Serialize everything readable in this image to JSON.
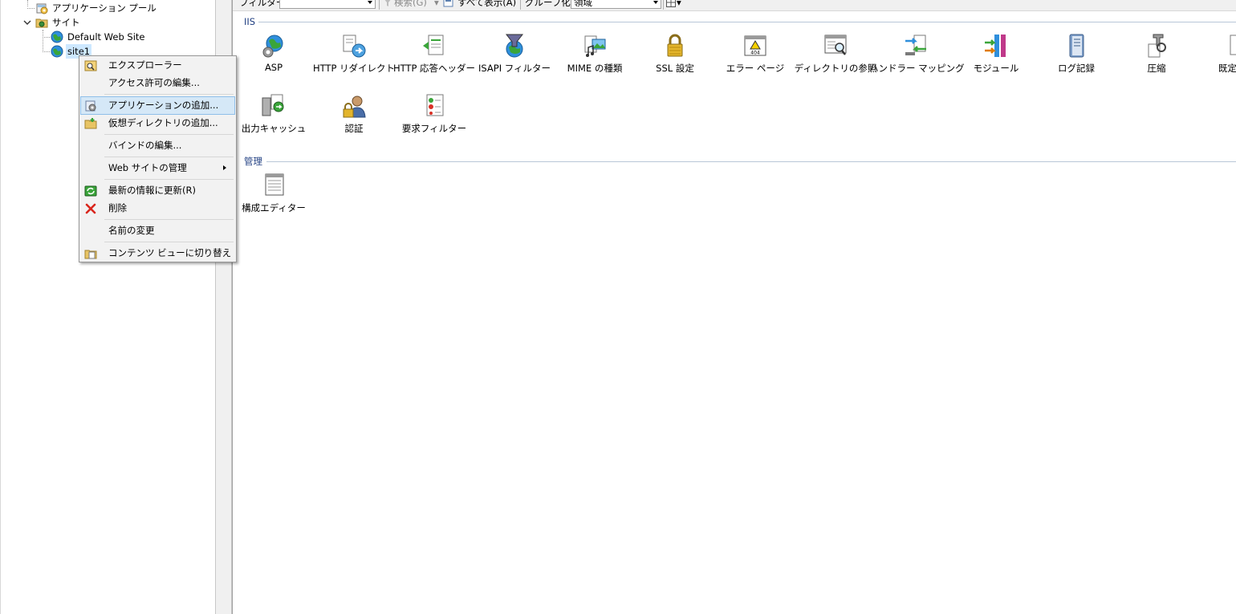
{
  "tree": {
    "items": [
      {
        "label": "アプリケーション プール"
      },
      {
        "label": "サイト"
      },
      {
        "label": "Default Web Site"
      },
      {
        "label": "site1"
      }
    ]
  },
  "toolbar": {
    "filter_label": "フィルター:",
    "filter_value": "",
    "search_label": "検索(G)",
    "show_all_label": "すべて表示(A)",
    "group_by_label": "グループ化:",
    "group_by_value": "領域"
  },
  "groups": {
    "iis": {
      "header": "IIS",
      "features": [
        {
          "label": "ASP",
          "icon": "asp-icon"
        },
        {
          "label": "HTTP リダイレクト",
          "icon": "http-redirect-icon"
        },
        {
          "label": "HTTP 応答ヘッダー",
          "icon": "http-response-headers-icon"
        },
        {
          "label": "ISAPI フィルター",
          "icon": "isapi-filters-icon"
        },
        {
          "label": "MIME の種類",
          "icon": "mime-types-icon"
        },
        {
          "label": "SSL 設定",
          "icon": "ssl-settings-icon"
        },
        {
          "label": "エラー ページ",
          "icon": "error-pages-icon"
        },
        {
          "label": "ディレクトリの参照",
          "icon": "directory-browsing-icon"
        },
        {
          "label": "ハンドラー マッピング",
          "icon": "handler-mappings-icon"
        },
        {
          "label": "モジュール",
          "icon": "modules-icon"
        },
        {
          "label": "ログ記録",
          "icon": "logging-icon"
        },
        {
          "label": "圧縮",
          "icon": "compression-icon"
        },
        {
          "label": "既定のド",
          "icon": "default-document-icon"
        },
        {
          "label": "出力キャッシュ",
          "icon": "output-caching-icon"
        },
        {
          "label": "認証",
          "icon": "authentication-icon"
        },
        {
          "label": "要求フィルター",
          "icon": "request-filtering-icon"
        }
      ]
    },
    "management": {
      "header": "管理",
      "features": [
        {
          "label": "構成エディター",
          "icon": "configuration-editor-icon"
        }
      ]
    }
  },
  "context_menu": {
    "items": [
      {
        "label": "エクスプローラー",
        "icon": "explore-icon"
      },
      {
        "label": "アクセス許可の編集...",
        "icon": ""
      },
      {
        "label": "アプリケーションの追加...",
        "icon": "add-application-icon"
      },
      {
        "label": "仮想ディレクトリの追加...",
        "icon": "add-virtual-directory-icon"
      },
      {
        "label": "バインドの編集...",
        "icon": ""
      },
      {
        "label": "Web サイトの管理",
        "icon": ""
      },
      {
        "label": "最新の情報に更新(R)",
        "icon": "refresh-icon"
      },
      {
        "label": "削除",
        "icon": "delete-icon"
      },
      {
        "label": "名前の変更",
        "icon": ""
      },
      {
        "label": "コンテンツ ビューに切り替え",
        "icon": "content-view-icon"
      }
    ]
  },
  "colors": {
    "group_header": "#1e3d80",
    "menu_hover": "#d5e8f7",
    "tree_selection": "#cde8ff"
  }
}
